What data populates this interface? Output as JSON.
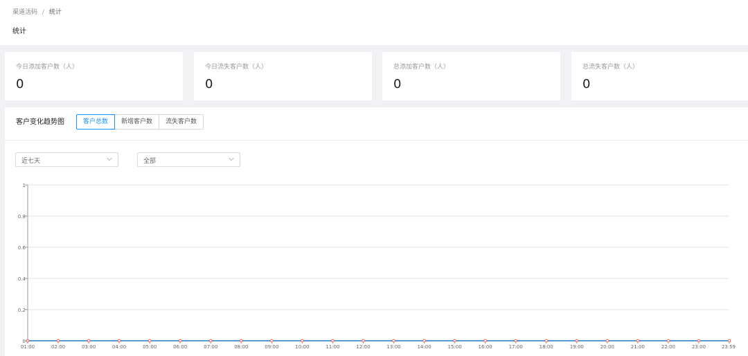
{
  "breadcrumb": {
    "parent": "渠道活码",
    "separator": "/",
    "current": "统计"
  },
  "page_title": "统计",
  "stats": [
    {
      "label": "今日添加客户数（人）",
      "value": "0"
    },
    {
      "label": "今日流失客户数（人）",
      "value": "0"
    },
    {
      "label": "总添加客户数（人）",
      "value": "0"
    },
    {
      "label": "总流失客户数（人）",
      "value": "0"
    }
  ],
  "trend": {
    "title": "客户变化趋势图",
    "tabs": [
      {
        "label": "客户总数",
        "active": true
      },
      {
        "label": "新增客户数",
        "active": false
      },
      {
        "label": "流失客户数",
        "active": false
      }
    ],
    "range_select": {
      "value": "近七天",
      "icon": "chevron-down-icon"
    },
    "scope_select": {
      "value": "全部",
      "icon": "chevron-down-icon"
    }
  },
  "colors": {
    "accent": "#1890ff",
    "line": "#5b9bd5",
    "point": "#f25c5c"
  },
  "chart_data": {
    "type": "line",
    "x": [
      "01:00",
      "02:00",
      "03:00",
      "04:00",
      "05:00",
      "06:00",
      "07:00",
      "08:00",
      "09:00",
      "10:00",
      "11:00",
      "12:00",
      "13:00",
      "14:00",
      "15:00",
      "16:00",
      "17:00",
      "18:00",
      "19:00",
      "20:00",
      "21:00",
      "22:00",
      "23:00",
      "23:59"
    ],
    "series": [
      {
        "values": [
          0,
          0,
          0,
          0,
          0,
          0,
          0,
          0,
          0,
          0,
          0,
          0,
          0,
          0,
          0,
          0,
          0,
          0,
          0,
          0,
          0,
          0,
          0,
          0
        ]
      }
    ],
    "yticks": [
      "0",
      "0.2",
      "0.4",
      "0.6",
      "0.8",
      "1"
    ],
    "ylim": [
      0,
      1
    ],
    "grid": true
  }
}
